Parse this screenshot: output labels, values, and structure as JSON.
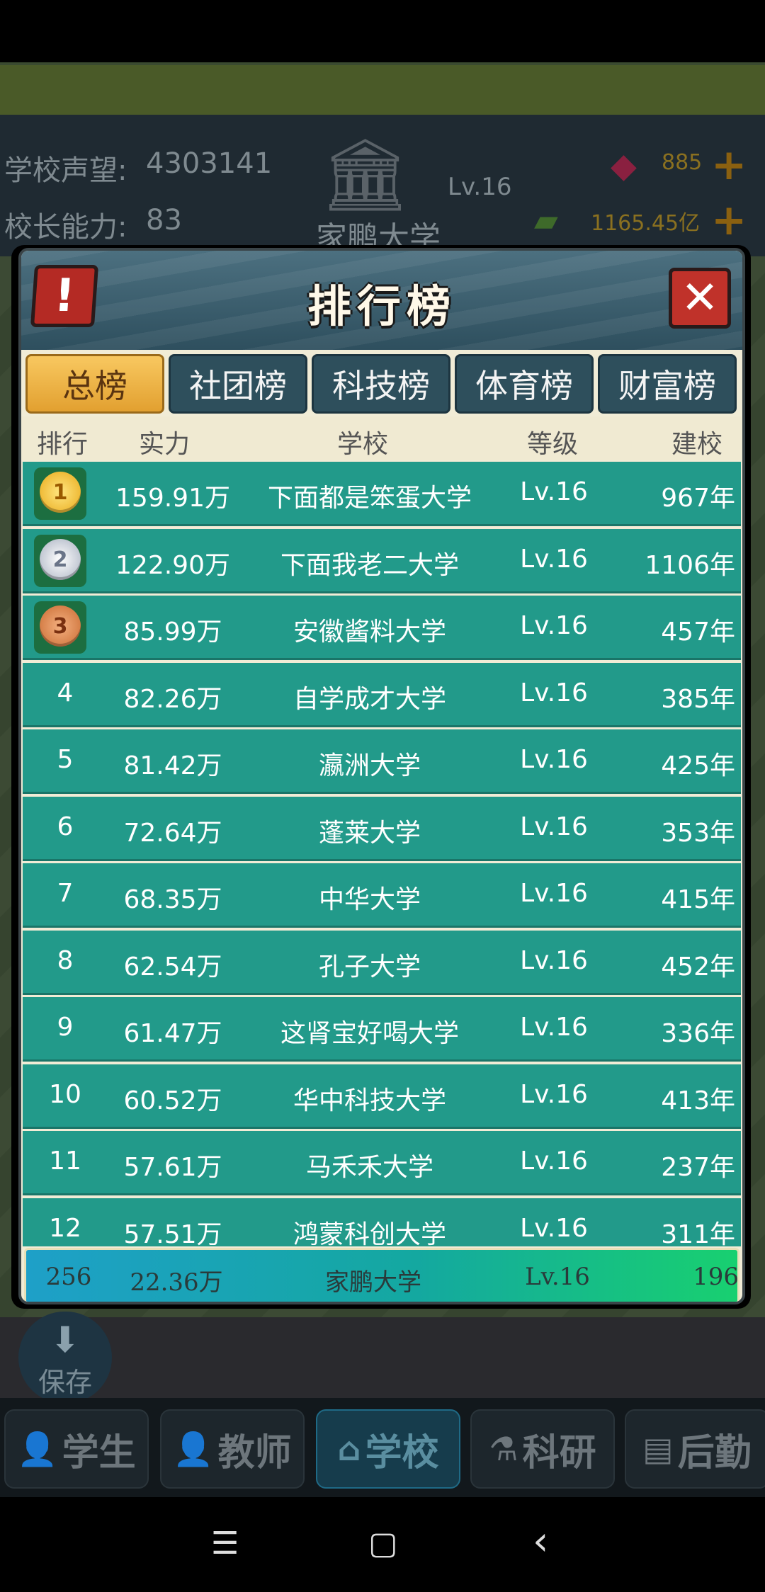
{
  "hud": {
    "reputation_label": "学校声望:",
    "reputation_value": "4303141",
    "ability_label": "校长能力:",
    "ability_value": "83",
    "school_name": "家鹏大学",
    "school_level": "Lv.16",
    "gems": "885",
    "money": "1165.45亿"
  },
  "modal": {
    "title": "排行榜",
    "alert_glyph": "!",
    "close_glyph": "✕",
    "tabs": [
      {
        "label": "总榜",
        "active": true
      },
      {
        "label": "社团榜",
        "active": false
      },
      {
        "label": "科技榜",
        "active": false
      },
      {
        "label": "体育榜",
        "active": false
      },
      {
        "label": "财富榜",
        "active": false
      }
    ],
    "columns": {
      "rank": "排行",
      "power": "实力",
      "school": "学校",
      "level": "等级",
      "founded": "建校"
    },
    "rows": [
      {
        "rank": "1",
        "power": "159.91万",
        "school": "下面都是笨蛋大学",
        "level": "Lv.16",
        "founded": "967年",
        "medal": "gold"
      },
      {
        "rank": "2",
        "power": "122.90万",
        "school": "下面我老二大学",
        "level": "Lv.16",
        "founded": "1106年",
        "medal": "silver"
      },
      {
        "rank": "3",
        "power": "85.99万",
        "school": "安徽酱料大学",
        "level": "Lv.16",
        "founded": "457年",
        "medal": "bronze"
      },
      {
        "rank": "4",
        "power": "82.26万",
        "school": "自学成才大学",
        "level": "Lv.16",
        "founded": "385年"
      },
      {
        "rank": "5",
        "power": "81.42万",
        "school": "瀛洲大学",
        "level": "Lv.16",
        "founded": "425年"
      },
      {
        "rank": "6",
        "power": "72.64万",
        "school": "蓬莱大学",
        "level": "Lv.16",
        "founded": "353年"
      },
      {
        "rank": "7",
        "power": "68.35万",
        "school": "中华大学",
        "level": "Lv.16",
        "founded": "415年"
      },
      {
        "rank": "8",
        "power": "62.54万",
        "school": "孔子大学",
        "level": "Lv.16",
        "founded": "452年"
      },
      {
        "rank": "9",
        "power": "61.47万",
        "school": "这肾宝好喝大学",
        "level": "Lv.16",
        "founded": "336年"
      },
      {
        "rank": "10",
        "power": "60.52万",
        "school": "华中科技大学",
        "level": "Lv.16",
        "founded": "413年"
      },
      {
        "rank": "11",
        "power": "57.61万",
        "school": "马禾禾大学",
        "level": "Lv.16",
        "founded": "237年"
      },
      {
        "rank": "12",
        "power": "57.51万",
        "school": "鸿蒙科创大学",
        "level": "Lv.16",
        "founded": "311年"
      }
    ],
    "my_row": {
      "rank": "256",
      "power": "22.36万",
      "school": "家鹏大学",
      "level": "Lv.16",
      "founded": "196"
    }
  },
  "save_label": "保存",
  "bottom_nav": [
    {
      "label": "学生",
      "icon": "student-icon",
      "glyph": "👤",
      "active": false
    },
    {
      "label": "教师",
      "icon": "teacher-icon",
      "glyph": "👤",
      "active": false
    },
    {
      "label": "学校",
      "icon": "school-icon",
      "glyph": "⌂",
      "active": true
    },
    {
      "label": "科研",
      "icon": "flask-icon",
      "glyph": "⚗",
      "active": false
    },
    {
      "label": "后勤",
      "icon": "clipboard-icon",
      "glyph": "▤",
      "active": false
    }
  ],
  "system_nav": {
    "menu": "☰",
    "home": "▢",
    "back": "‹"
  }
}
